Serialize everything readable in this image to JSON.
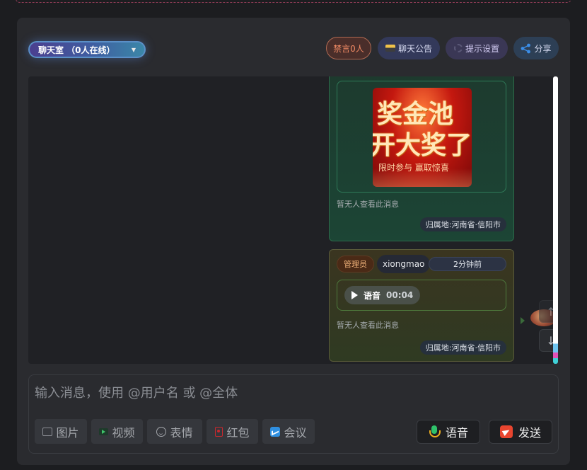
{
  "header": {
    "room_label": "聊天室 （0人在线）",
    "mute_label": "禁言0人",
    "notice_label": "聊天公告",
    "remind_label": "提示设置",
    "share_label": "分享"
  },
  "messages": [
    {
      "type": "image",
      "poster": {
        "line1": "奖金池",
        "line2": "开大奖了",
        "line3": "限时参与 赢取惊喜"
      },
      "read_status": "暂无人查看此消息",
      "location": "归属地:河南省·信阳市"
    },
    {
      "type": "voice",
      "role": "管理员",
      "username": "xiongmao",
      "time": "2分钟前",
      "voice_label": "语音",
      "voice_duration": "00:04",
      "read_status": "暂无人查看此消息",
      "location": "归属地:河南省·信阳市"
    }
  ],
  "scroll": {
    "up_icon": "↑",
    "down_icon": "↓"
  },
  "composer": {
    "placeholder": "输入消息，使用 @用户名 或 @全体",
    "tools": {
      "image": "图片",
      "video": "视频",
      "emoji": "表情",
      "redpacket": "红包",
      "meeting": "会议"
    },
    "voice_button": "语音",
    "send_button": "发送"
  },
  "icons": [
    "caret-down-icon",
    "card-icon",
    "gear-icon",
    "share-icon",
    "play-icon",
    "image-icon",
    "video-icon",
    "emoji-icon",
    "redpacket-icon",
    "meeting-icon",
    "mic-icon",
    "send-icon",
    "arrow-up-icon",
    "arrow-down-icon"
  ],
  "colors": {
    "accent_mute": "#f08a64",
    "online_pill": "#3f5ea1",
    "send": "#e8452f",
    "voice": "#2fc26a"
  }
}
